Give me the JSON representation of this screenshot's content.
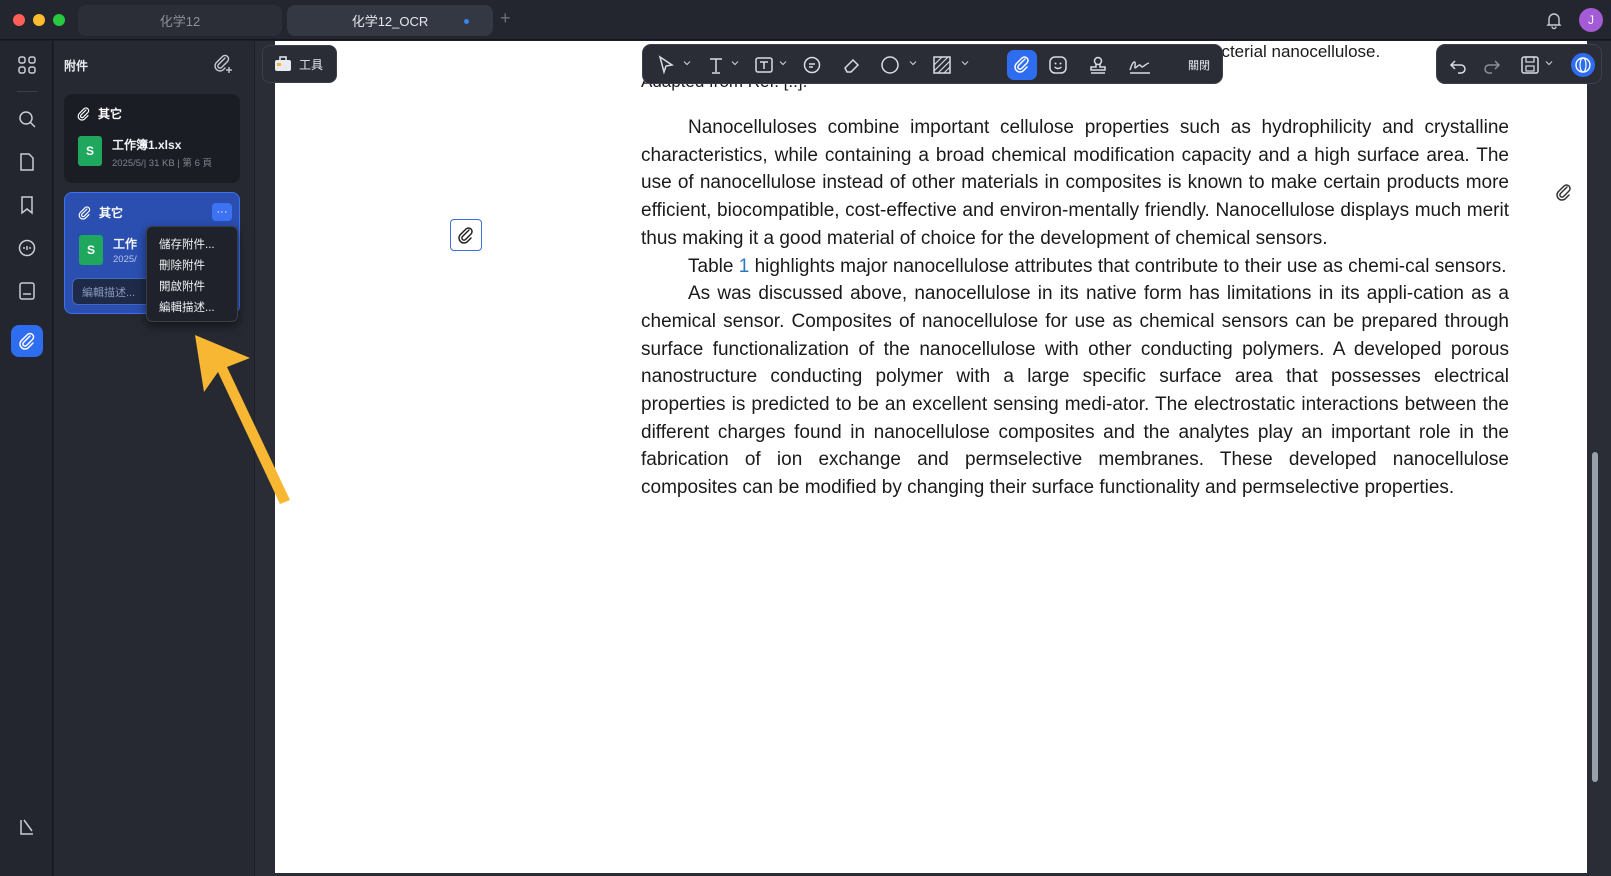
{
  "window": {
    "tabs": [
      {
        "label": "化学12"
      },
      {
        "label": "化学12_OCR"
      }
    ],
    "add_tab": "+",
    "avatar_initial": "J"
  },
  "panel": {
    "title": "附件",
    "cards": [
      {
        "category": "其它",
        "file_name": "工作簿1.xlsx",
        "meta": "2025/5/| 31 KB | 第 6 頁",
        "file_icon_letter": "S"
      },
      {
        "category": "其它",
        "file_name": "工作",
        "meta": "2025/",
        "file_icon_letter": "S",
        "more": "···",
        "description_placeholder": "編輯描述..."
      }
    ],
    "context_menu": [
      "儲存附件...",
      "刪除附件",
      "開啟附件",
      "編輯描述..."
    ]
  },
  "tools_button": {
    "label": "工具"
  },
  "toolbar": {
    "close_label": "關閉"
  },
  "document": {
    "cut_top": "acterial nanocellulose.",
    "cut_left": "Adapted from Ref. [..].",
    "paragraphs": [
      "Nanocelluloses combine important cellulose properties such as hydrophilicity and crystalline characteristics, while containing a broad chemical modification capacity and a high surface area. The use of nanocellulose instead of other materials in composites is known to make certain products more efficient, biocompatible, cost-effective and environ-mentally friendly. Nanocellulose displays much merit thus making it a good material of choice for the development of chemical sensors.",
      "highlights major nanocellulose attributes that contribute to their use as chemi-cal sensors.",
      "As was discussed above, nanocellulose in its native form has limitations in its appli-cation as a chemical sensor. Composites of nanocellulose for use as chemical sensors can be prepared through surface functionalization of the nanocellulose with other conducting polymers. A developed porous nanostructure conducting polymer with a large specific surface area that possesses electrical properties is predicted to be an excellent sensing medi-ator. The electrostatic interactions between the different charges found in nanocellulose composites and the analytes play an important role in the fabrication of ion exchange and permselective membranes. These developed nanocellulose composites can be modified by changing their surface functionality and permselective properties."
    ],
    "table_ref_word": "Table",
    "table_ref_num": "1"
  },
  "colors": {
    "accent": "#2f6df0",
    "arrow": "#f7b733",
    "xls": "#1fa85d"
  }
}
